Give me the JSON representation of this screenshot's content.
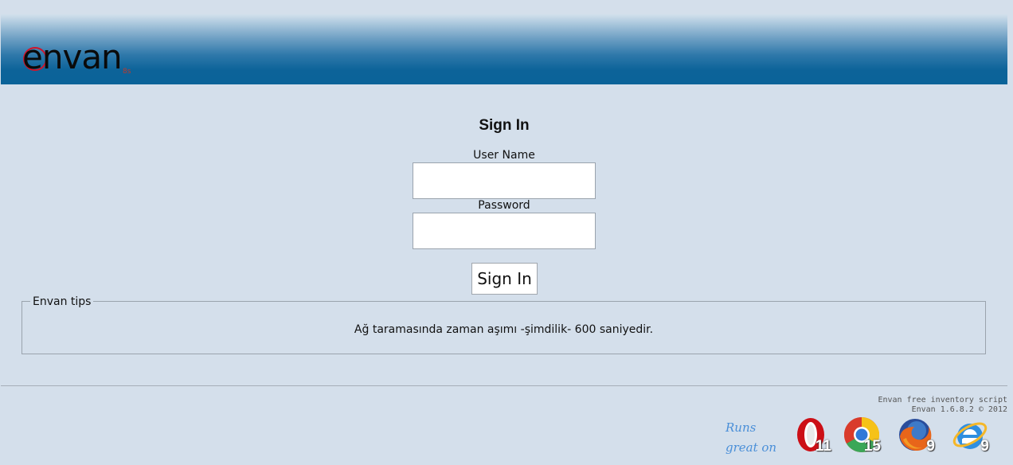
{
  "header": {
    "logo_text": "envan",
    "logo_sub": "8s"
  },
  "login": {
    "title": "Sign In",
    "username_label": "User Name",
    "username_value": "",
    "password_label": "Password",
    "password_value": "",
    "submit_label": "Sign In"
  },
  "tips": {
    "legend": "Envan tips",
    "text": "Ağ taramasında zaman aşımı -şimdilik- 600 saniyedir."
  },
  "footer": {
    "line1": "Envan free inventory script",
    "line2": "Envan 1.6.8.2 © 2012",
    "runs_line1": "Runs",
    "runs_line2": "great on",
    "browsers": [
      {
        "name": "opera-icon",
        "version": "11"
      },
      {
        "name": "chrome-icon",
        "version": "15"
      },
      {
        "name": "firefox-icon",
        "version": "9"
      },
      {
        "name": "ie-icon",
        "version": "9"
      }
    ]
  },
  "colors": {
    "background": "#d4dfeb",
    "header_dark": "#0a6399",
    "logo_ring": "#d0142a",
    "runs_text": "#4a8fd8"
  }
}
